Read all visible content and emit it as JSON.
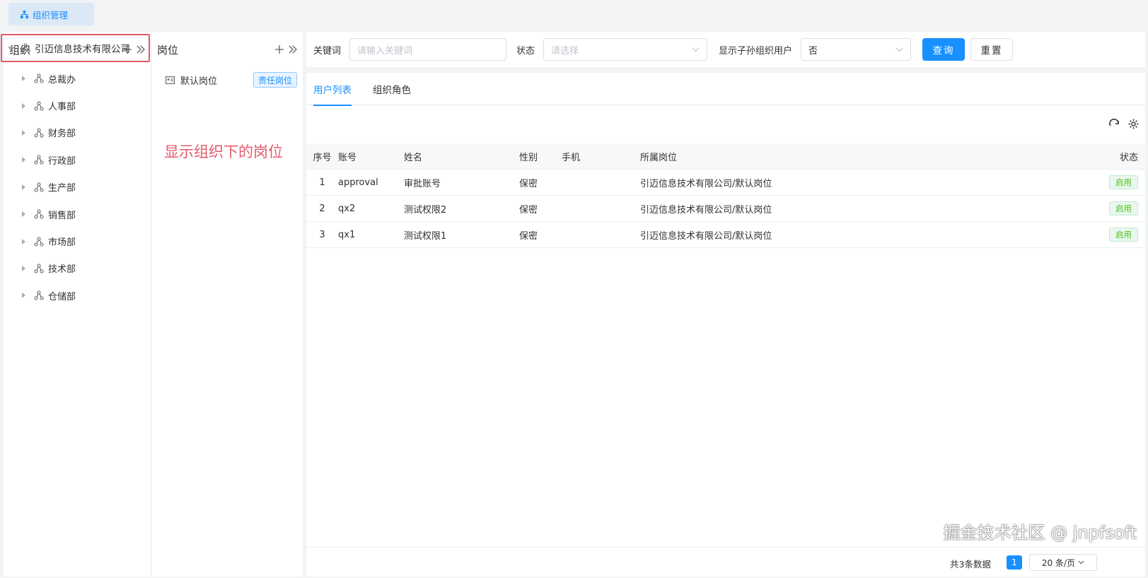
{
  "tab": {
    "label": "组织管理"
  },
  "org_panel": {
    "title": "组织",
    "root": "引迈信息技术有限公司",
    "children": [
      "总裁办",
      "人事部",
      "财务部",
      "行政部",
      "生产部",
      "销售部",
      "市场部",
      "技术部",
      "仓储部"
    ]
  },
  "pos_panel": {
    "title": "岗位",
    "item": {
      "label": "默认岗位",
      "tag": "责任岗位"
    },
    "annotation": "显示组织下的岗位"
  },
  "search": {
    "keyword_label": "关键词",
    "keyword_placeholder": "请输入关键词",
    "status_label": "状态",
    "status_placeholder": "请选择",
    "sub_label": "显示子孙组织用户",
    "sub_value": "否",
    "query_btn": "查询",
    "reset_btn": "重置"
  },
  "main": {
    "tabs": [
      "用户列表",
      "组织角色"
    ],
    "table": {
      "headers": {
        "idx": "序号",
        "account": "账号",
        "name": "姓名",
        "sex": "性别",
        "phone": "手机",
        "position": "所属岗位",
        "status": "状态"
      },
      "rows": [
        {
          "idx": "1",
          "account": "approval",
          "name": "审批账号",
          "sex": "保密",
          "phone": "",
          "position": "引迈信息技术有限公司/默认岗位",
          "status": "启用"
        },
        {
          "idx": "2",
          "account": "qx2",
          "name": "测试权限2",
          "sex": "保密",
          "phone": "",
          "position": "引迈信息技术有限公司/默认岗位",
          "status": "启用"
        },
        {
          "idx": "3",
          "account": "qx1",
          "name": "测试权限1",
          "sex": "保密",
          "phone": "",
          "position": "引迈信息技术有限公司/默认岗位",
          "status": "启用"
        }
      ]
    },
    "pager": {
      "total": "共3条数据",
      "page": "1",
      "size": "20 条/页"
    }
  },
  "watermark": "掘金技术社区 @ jnpfsoft",
  "colors": {
    "primary": "#1890ff",
    "annotation": "#e35a6b",
    "success": "#52c41a"
  }
}
